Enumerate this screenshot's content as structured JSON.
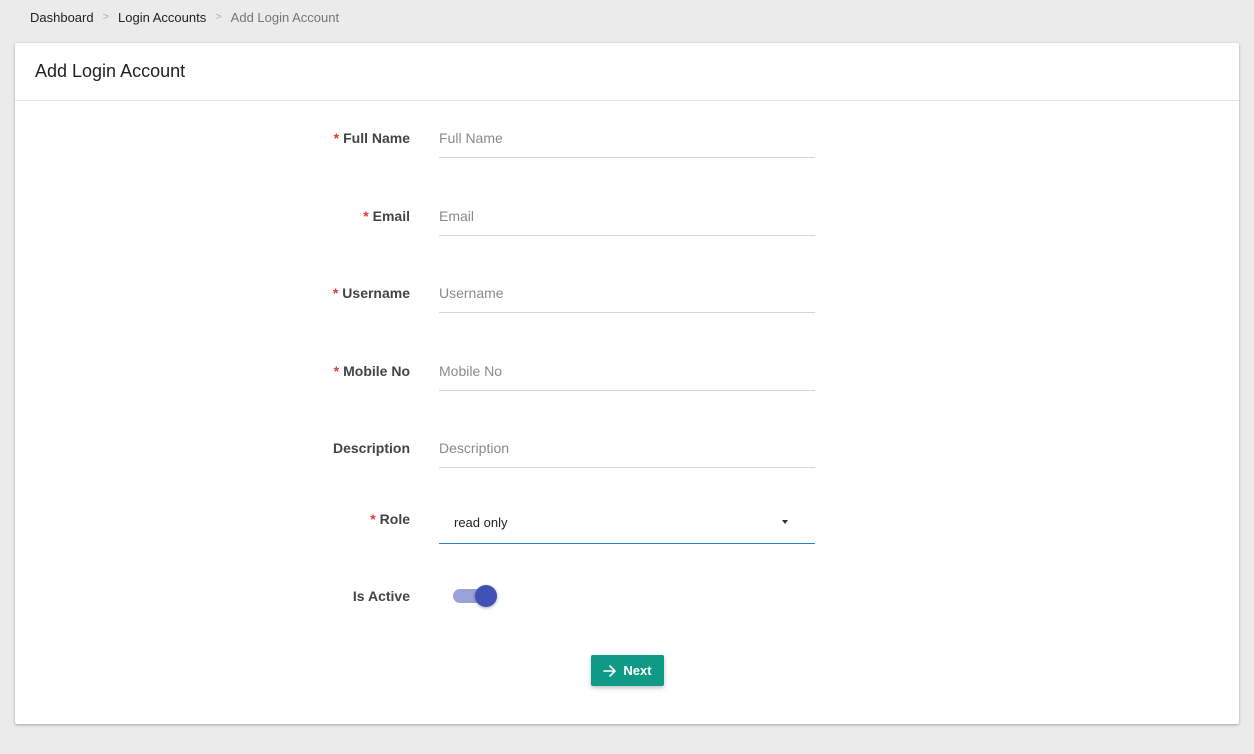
{
  "breadcrumb": {
    "items": [
      "Dashboard",
      "Login Accounts",
      "Add Login Account"
    ],
    "separator": ">"
  },
  "card": {
    "title": "Add Login Account"
  },
  "form": {
    "full_name": {
      "label": "Full Name",
      "placeholder": "Full Name",
      "value": "",
      "required": true
    },
    "email": {
      "label": "Email",
      "placeholder": "Email",
      "value": "",
      "required": true
    },
    "username": {
      "label": "Username",
      "placeholder": "Username",
      "value": "",
      "required": true
    },
    "mobile_no": {
      "label": "Mobile No",
      "placeholder": "Mobile No",
      "value": "",
      "required": true
    },
    "description": {
      "label": "Description",
      "placeholder": "Description",
      "value": "",
      "required": false
    },
    "role": {
      "label": "Role",
      "selected": "read only",
      "required": true
    },
    "is_active": {
      "label": "Is Active",
      "checked": true
    }
  },
  "required_marker": "*",
  "actions": {
    "next_label": "Next"
  },
  "colors": {
    "accent_teal": "#0f9a86",
    "toggle_thumb": "#3f51b5",
    "toggle_track": "#9aa3d9",
    "required": "#e53935",
    "select_underline": "#2f7fc8"
  },
  "icons": {
    "next": "arrow-right-icon",
    "role_dropdown": "caret-down-icon"
  }
}
